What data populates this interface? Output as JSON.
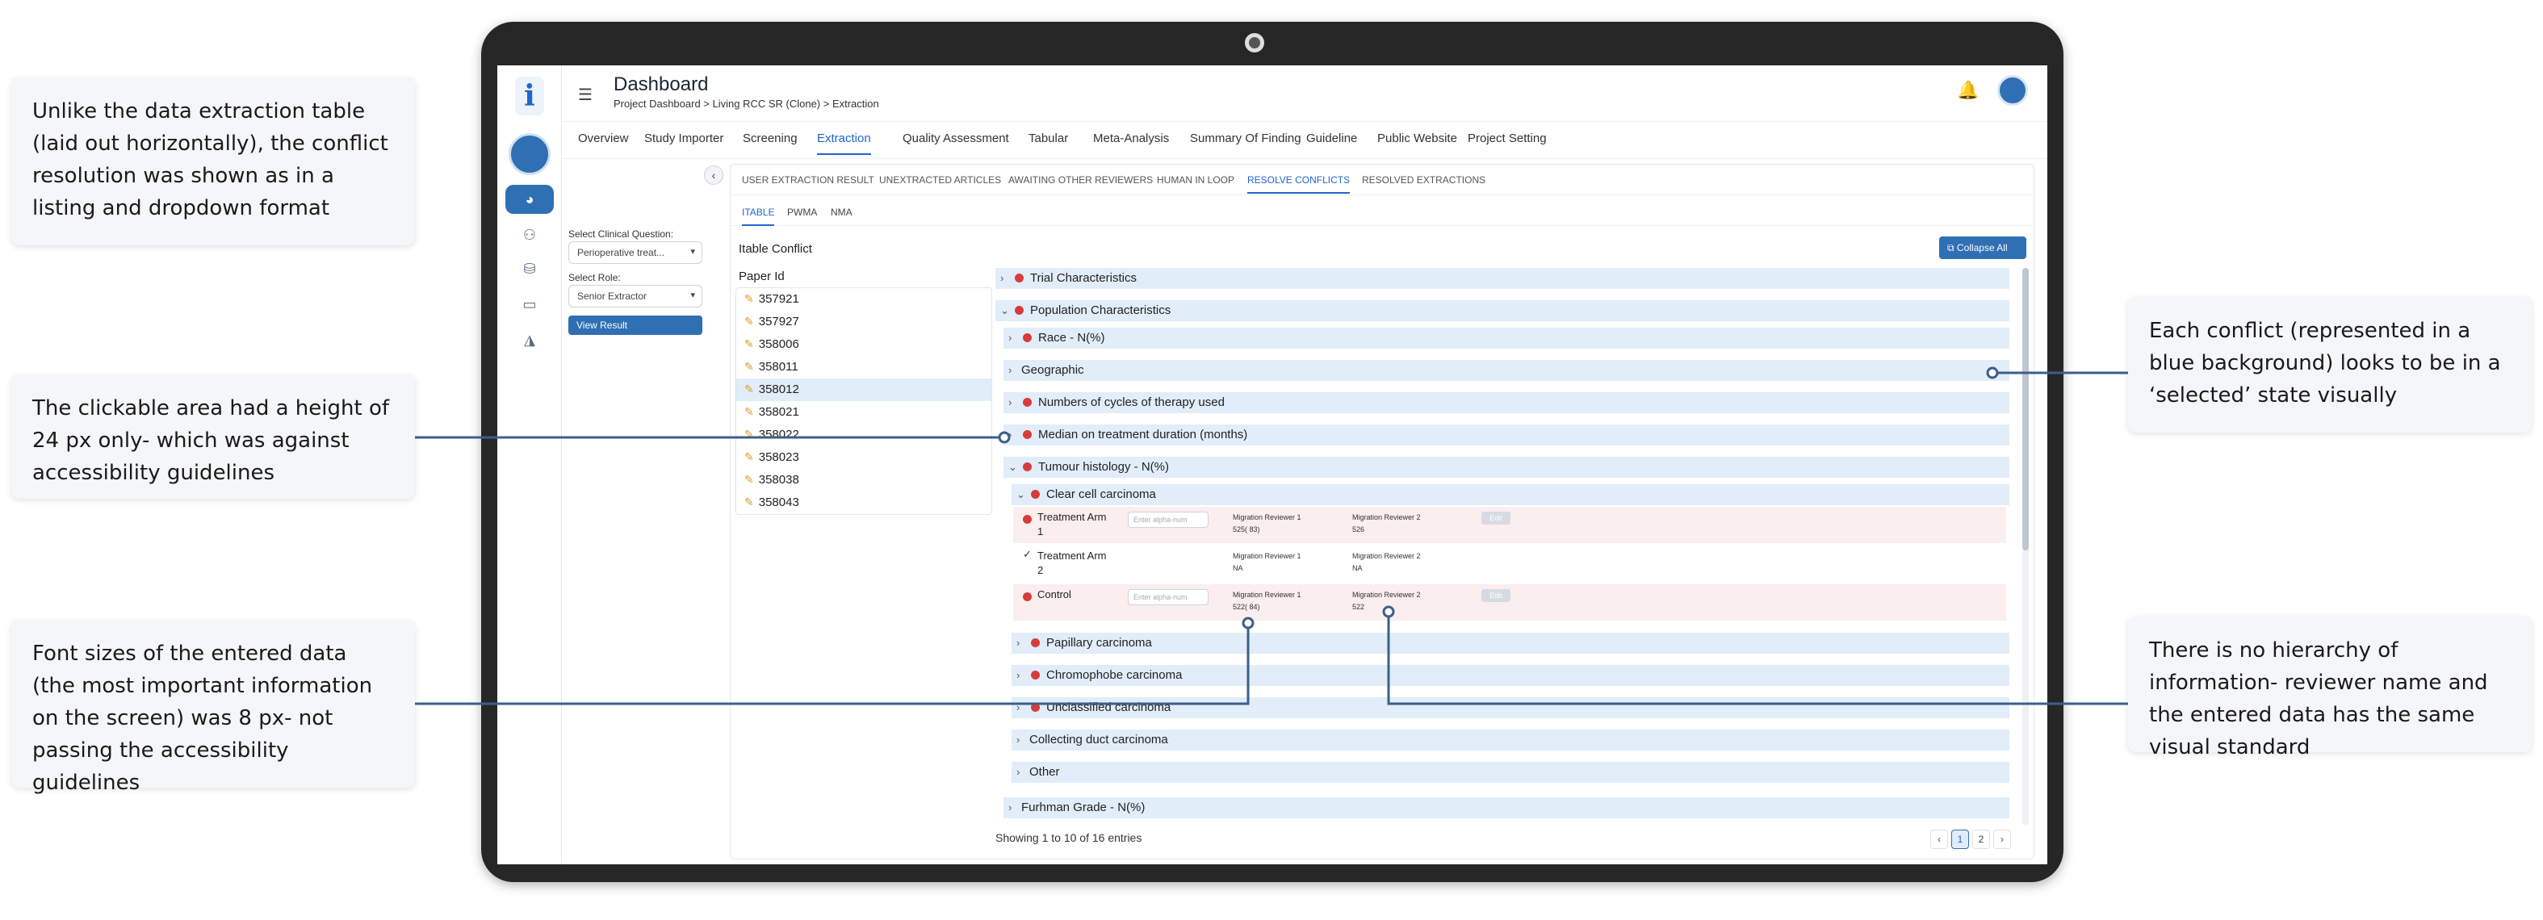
{
  "callouts": [
    "Unlike the data extraction table (laid out horizontally), the conflict resolution was shown as in a listing and dropdown format",
    "The clickable area had a height of 24 px only- which was against accessibility guidelines",
    "Font sizes of the entered data (the most important information on the screen) was 8 px- not passing the accessibility guidelines",
    "Each conflict (represented in a blue background) looks to be in a ‘selected’ state visually",
    "There is no hierarchy of information- reviewer name and the entered data has the same visual standard"
  ],
  "app": {
    "logo": "i",
    "title": "Dashboard",
    "breadcrumb": "Project Dashboard > Living RCC SR (Clone) > Extraction"
  },
  "tabs": [
    "Overview",
    "Study Importer",
    "Screening",
    "Extraction",
    "Quality Assessment",
    "Tabular",
    "Meta-Analysis",
    "Summary Of Finding",
    "Guideline",
    "Public Website",
    "Project Setting"
  ],
  "active_tab": "Extraction",
  "left_panel": {
    "question_label": "Select Clinical Question:",
    "question_value": "Perioperative treat...",
    "role_label": "Select Role:",
    "role_value": "Senior Extractor",
    "view_button": "View Result"
  },
  "subtabs": [
    "USER EXTRACTION RESULT",
    "UNEXTRACTED ARTICLES",
    "AWAITING OTHER REVIEWERS",
    "HUMAN IN LOOP",
    "RESOLVE CONFLICTS",
    "RESOLVED EXTRACTIONS"
  ],
  "active_subtab": "RESOLVE CONFLICTS",
  "table_tabs": [
    "ITABLE",
    "PWMA",
    "NMA"
  ],
  "active_table_tab": "ITABLE",
  "section_title": "Itable Conflict",
  "collapse_all": "Collapse All",
  "paper_id_title": "Paper Id",
  "paper_ids": [
    "357921",
    "357927",
    "358006",
    "358011",
    "358012",
    "358021",
    "358022",
    "358023",
    "358038",
    "358043"
  ],
  "selected_paper": "358012",
  "conflicts": [
    {
      "label": "Trial Characteristics",
      "chevron": "›",
      "error": true
    },
    {
      "label": "Population Characteristics",
      "chevron": "⌄",
      "error": true
    },
    {
      "label": "Race - N(%)",
      "chevron": "›",
      "error": true
    },
    {
      "label": "Geographic",
      "chevron": "›",
      "error": false
    },
    {
      "label": "Numbers of cycles of therapy used",
      "chevron": "›",
      "error": true
    },
    {
      "label": "Median on treatment duration (months)",
      "chevron": "›",
      "error": true
    },
    {
      "label": "Tumour histology - N(%)",
      "chevron": "⌄",
      "error": true
    },
    {
      "label": "Clear cell carcinoma",
      "chevron": "⌄",
      "error": true
    },
    {
      "label": "Papillary carcinoma",
      "chevron": "›",
      "error": true
    },
    {
      "label": "Chromophobe carcinoma",
      "chevron": "›",
      "error": true
    },
    {
      "label": "Unclassified carcinoma",
      "chevron": "›",
      "error": true
    },
    {
      "label": "Collecting duct carcinoma",
      "chevron": "›",
      "error": false
    },
    {
      "label": "Other",
      "chevron": "›",
      "error": false
    },
    {
      "label": "Furhman Grade - N(%)",
      "chevron": "›",
      "error": false
    }
  ],
  "details": [
    {
      "arm": "Treatment Arm 1",
      "placeholder": "Enter alpha-num",
      "rev1_name": "Migration Reviewer 1",
      "rev1_value": "525( 83)",
      "rev2_name": "Migration Reviewer 2",
      "rev2_value": "526",
      "edit": "Edit",
      "conflict": true
    },
    {
      "arm": "Treatment Arm 2",
      "placeholder": "",
      "rev1_name": "Migration Reviewer 1",
      "rev1_value": "NA",
      "rev2_name": "Migration Reviewer 2",
      "rev2_value": "NA",
      "edit": "",
      "conflict": false
    },
    {
      "arm": "Control",
      "placeholder": "Enter alpha-num",
      "rev1_name": "Migration Reviewer 1",
      "rev1_value": "522( 84)",
      "rev2_name": "Migration Reviewer 2",
      "rev2_value": "522",
      "edit": "Edit",
      "conflict": true
    }
  ],
  "footer": {
    "entries": "Showing 1 to 10 of 16 entries",
    "pages": [
      "‹",
      "1",
      "2",
      "›"
    ],
    "current_page": "1"
  },
  "colors": {
    "accent": "#2f6fb3",
    "conflict_bg": "#e1edf9",
    "error": "#d93b3b",
    "annotation_line": "#3b5f8a"
  }
}
